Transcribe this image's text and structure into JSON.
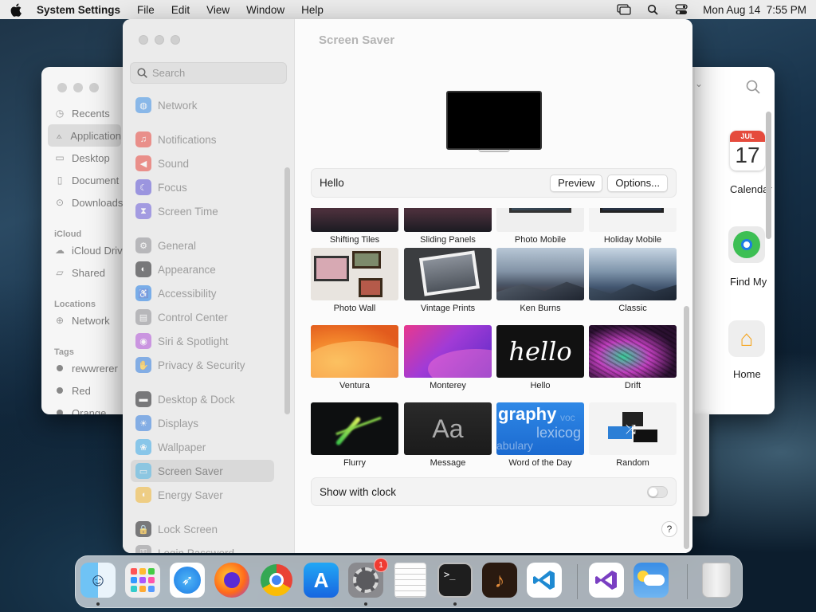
{
  "menubar": {
    "app_name": "System Settings",
    "menus": [
      "File",
      "Edit",
      "View",
      "Window",
      "Help"
    ],
    "clock": "Mon Aug 14  7:55 PM"
  },
  "finder": {
    "sidebar": [
      {
        "label": "Recents",
        "icon": "clock-icon"
      },
      {
        "label": "Application",
        "icon": "apps-icon",
        "selected": true
      },
      {
        "label": "Desktop",
        "icon": "desktop-icon"
      },
      {
        "label": "Document",
        "icon": "doc-icon"
      },
      {
        "label": "Downloads",
        "icon": "download-icon"
      }
    ],
    "icloud_head": "iCloud",
    "icloud_items": [
      {
        "label": "iCloud Driv",
        "icon": "cloud-icon"
      },
      {
        "label": "Shared",
        "icon": "shared-folder-icon"
      }
    ],
    "locations_head": "Locations",
    "locations_items": [
      {
        "label": "Network",
        "icon": "globe-icon"
      }
    ],
    "tags_head": "Tags",
    "tags": [
      "rewwrerer",
      "Red",
      "Orange"
    ],
    "apps": {
      "calendar_month": "JUL",
      "calendar_day": "17",
      "calendar_label": "Calendar",
      "findmy_label": "Find My",
      "home_label": "Home"
    }
  },
  "settings": {
    "search_placeholder": "Search",
    "sidebar": [
      {
        "label": "Network",
        "icon": "network-icon",
        "color": "#3a8ee6"
      },
      {
        "label": "Notifications",
        "icon": "bell-icon",
        "color": "#e8453c"
      },
      {
        "label": "Sound",
        "icon": "speaker-icon",
        "color": "#e8453c"
      },
      {
        "label": "Focus",
        "icon": "moon-icon",
        "color": "#5b4fd6"
      },
      {
        "label": "Screen Time",
        "icon": "hourglass-icon",
        "color": "#6a5bd9"
      },
      {
        "label": "General",
        "icon": "gear-icon",
        "color": "#8e8e93"
      },
      {
        "label": "Appearance",
        "icon": "appearance-icon",
        "color": "#1c1c1e"
      },
      {
        "label": "Accessibility",
        "icon": "accessibility-icon",
        "color": "#1d7be6"
      },
      {
        "label": "Control Center",
        "icon": "control-center-icon",
        "color": "#8e8e93"
      },
      {
        "label": "Siri & Spotlight",
        "icon": "siri-icon",
        "color": "#b050d8"
      },
      {
        "label": "Privacy & Security",
        "icon": "hand-icon",
        "color": "#2f7be0"
      },
      {
        "label": "Desktop & Dock",
        "icon": "dock-icon",
        "color": "#1c1c1e"
      },
      {
        "label": "Displays",
        "icon": "sun-icon",
        "color": "#2f7be0"
      },
      {
        "label": "Wallpaper",
        "icon": "wallpaper-icon",
        "color": "#39a8e8"
      },
      {
        "label": "Screen Saver",
        "icon": "screensaver-icon",
        "color": "#4fb8e8",
        "selected": true
      },
      {
        "label": "Energy Saver",
        "icon": "battery-icon",
        "color": "#f2b630"
      },
      {
        "label": "Lock Screen",
        "icon": "lock-icon",
        "color": "#1c1c1e"
      },
      {
        "label": "Login Password",
        "icon": "key-icon",
        "color": "#8e8e93"
      }
    ],
    "content_title": "Screen Saver",
    "current_saver": "Hello",
    "preview_label": "Preview",
    "options_label": "Options...",
    "tiles": [
      {
        "label": "Shifting Tiles",
        "style": "dark-photo"
      },
      {
        "label": "Sliding Panels",
        "style": "dark-photo"
      },
      {
        "label": "Photo Mobile",
        "style": "photo-mobile"
      },
      {
        "label": "Holiday Mobile",
        "style": "holiday"
      },
      {
        "label": "Photo Wall",
        "style": "photo-wall"
      },
      {
        "label": "Vintage Prints",
        "style": "vintage"
      },
      {
        "label": "Ken Burns",
        "style": "mountains"
      },
      {
        "label": "Classic",
        "style": "mountains-blue"
      },
      {
        "label": "Ventura",
        "style": "ventura"
      },
      {
        "label": "Monterey",
        "style": "monterey"
      },
      {
        "label": "Hello",
        "style": "hello"
      },
      {
        "label": "Drift",
        "style": "drift"
      },
      {
        "label": "Flurry",
        "style": "flurry"
      },
      {
        "label": "Message",
        "style": "message"
      },
      {
        "label": "Word of the Day",
        "style": "word"
      },
      {
        "label": "Random",
        "style": "random"
      }
    ],
    "hello_text": "hello",
    "message_text": "Aa",
    "word_text_1": "graphy",
    "word_text_2": "lexicog",
    "word_text_3": "abulary",
    "word_text_4": "voc",
    "show_clock_label": "Show with clock",
    "show_clock_on": false,
    "help_label": "?"
  },
  "dock": {
    "apps": [
      {
        "name": "Finder",
        "icon": "finder-icon",
        "running": true
      },
      {
        "name": "Launchpad",
        "icon": "launchpad-icon",
        "running": false
      },
      {
        "name": "Safari",
        "icon": "safari-icon",
        "running": false
      },
      {
        "name": "Firefox",
        "icon": "firefox-icon",
        "running": false
      },
      {
        "name": "Chrome",
        "icon": "chrome-icon",
        "running": false
      },
      {
        "name": "App Store",
        "icon": "app-store-icon",
        "running": false
      },
      {
        "name": "System Settings",
        "icon": "settings-icon",
        "running": true,
        "badge": "1"
      },
      {
        "name": "TextEdit",
        "icon": "textedit-icon",
        "running": false
      },
      {
        "name": "Terminal",
        "icon": "terminal-icon",
        "running": true
      },
      {
        "name": "GarageBand",
        "icon": "garageband-icon",
        "running": false
      },
      {
        "name": "Visual Studio Code",
        "icon": "vscode-icon",
        "running": false
      },
      {
        "name": "Visual Studio",
        "icon": "visual-studio-icon",
        "running": false
      },
      {
        "name": "Weather",
        "icon": "weather-icon",
        "running": false
      },
      {
        "name": "Trash",
        "icon": "trash-icon",
        "running": false
      }
    ]
  }
}
